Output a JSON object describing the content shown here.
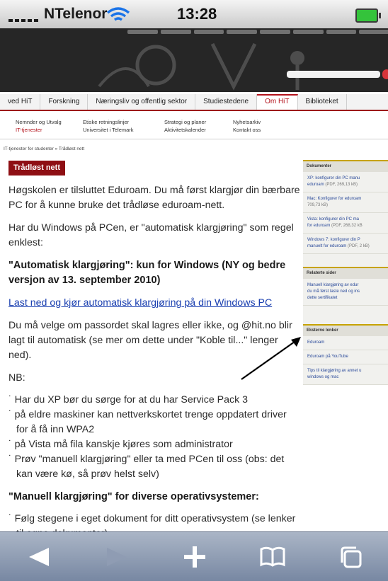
{
  "status": {
    "carrier": "NTelenor",
    "time": "13:28"
  },
  "nav": {
    "tabs": [
      "ved HiT",
      "Forskning",
      "Næringsliv og offentlig sektor",
      "Studiestedene",
      "Om HiT",
      "Biblioteket"
    ],
    "active": "Om HiT"
  },
  "submenu": {
    "col1": [
      "Nemnder og Utvalg",
      "IT-tjenester"
    ],
    "col2": [
      "Etiske retningslinjer",
      "Universitet i Telemark"
    ],
    "col3": [
      "Strategi og planer",
      "Aktivitetskalender"
    ],
    "col4": [
      "Nyhetsarkiv",
      "Kontakt oss"
    ]
  },
  "breadcrumb": "IT-tjenester for studenter » Trådløst nett",
  "main": {
    "tag": "Trådløst nett",
    "p1": "Høgskolen er tilsluttet Eduroam. Du må først klargjør din bærbare PC for å kunne bruke det trådløse eduroam-nett.",
    "p2": "Har du Windows på PCen, er \"automatisk klargjøring\" som regel enklest:",
    "h1_strong": "\"Automatisk klargjøring\"",
    "h1_rest": ": kun for Windows (NY og bedre versjon av 13. september 2010)",
    "link": "Last ned og kjør automatisk klargjøring på din Windows PC",
    "p3": "Du må velge om passordet skal lagres eller ikke, og @hit.no blir lagt til automatisk (se mer om dette under \"Koble til...\" lenger ned).",
    "nb": "NB:",
    "bullets": [
      "Har du XP bør du sørge for at du har Service Pack 3",
      "på eldre maskiner kan nettverkskortet trenge oppdatert driver for å få inn WPA2",
      "på Vista må fila kanskje kjøres som administrator",
      "Prøv \"manuell klargjøring\" eller ta med PCen til oss (obs: det kan være kø, så prøv helst selv)"
    ],
    "h2": "\"Manuell klargjøring\" for diverse operativsystemer:",
    "bullets2": [
      "Følg stegene i eget dokument for ditt operativsystem (se lenker til egne dokumenter)"
    ]
  },
  "sidebar": {
    "docs_head": "Dokumenter",
    "docs": [
      {
        "text": "XP: konfigurer din PC manu",
        "text2": "eduroam",
        "meta": "(PDF, 269,13 kB)"
      },
      {
        "text": "Mac: Konfigurer for eduroam",
        "text2": "",
        "meta": "709,73 kB)"
      },
      {
        "text": "Vista: konfigurer din PC ma",
        "text2": "for eduroam",
        "meta": "(PDF, 268,32 kB"
      },
      {
        "text": "Windows 7: konfigurer din P",
        "text2": "manuelt for eduroam",
        "meta": "(PDF, 2 kB)"
      }
    ],
    "related_head": "Relaterte sider",
    "related": [
      "Manuell klargjøring av edur",
      "du må først laste ned og ins",
      "dette sertifikatet"
    ],
    "external_head": "Eksterne lenker",
    "external": [
      "Eduroam",
      "Eduroam på YouTube",
      "Tips til klargjøring av annet u",
      "windows og mac"
    ]
  }
}
